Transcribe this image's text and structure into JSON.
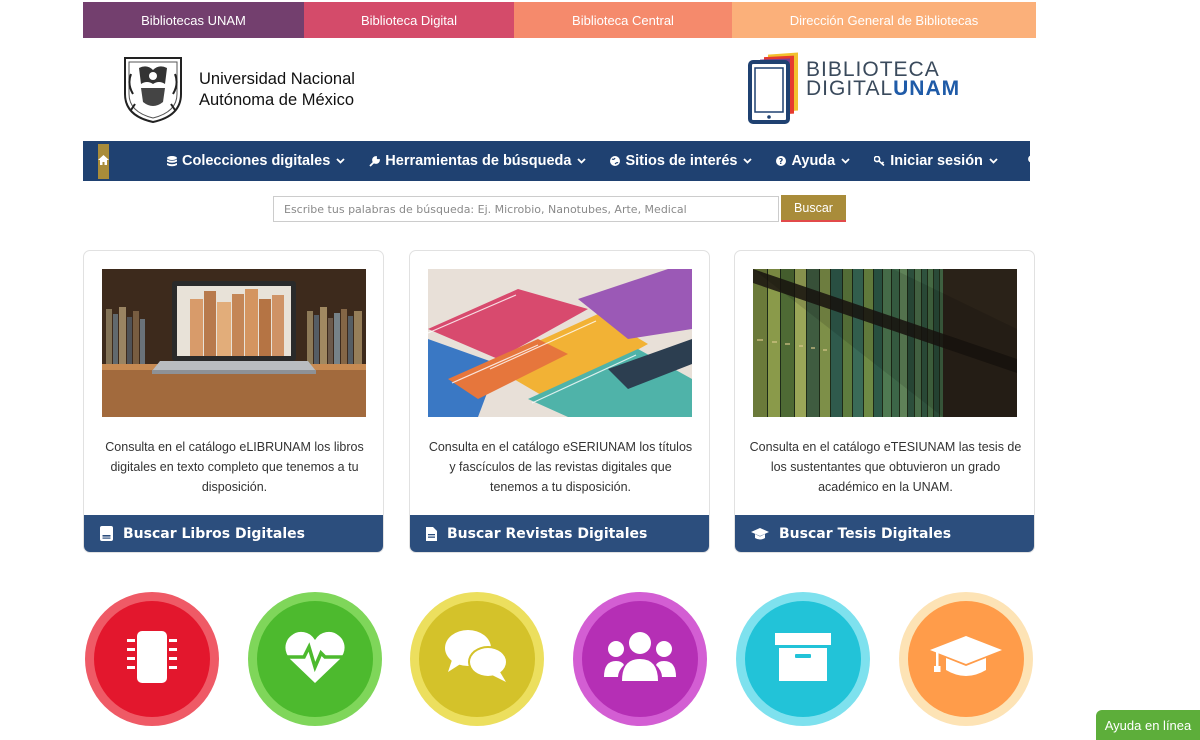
{
  "topbar": {
    "links": [
      "Bibliotecas UNAM",
      "Biblioteca Digital",
      "Biblioteca Central",
      "Dirección General de Bibliotecas"
    ],
    "colors": [
      "#733f6e",
      "#d44b6a",
      "#f58a6c",
      "#fbb07a"
    ]
  },
  "header": {
    "unam_line1": "Universidad Nacional",
    "unam_line2": "Autónoma de México",
    "logo_line1": "BIBLIOTECA",
    "logo_line2a": "DIGITAL",
    "logo_line2b": "UNAM"
  },
  "nav": {
    "home_icon": "home-icon",
    "items": [
      {
        "label": "Colecciones digitales",
        "icon": "database-icon"
      },
      {
        "label": "Herramientas de búsqueda",
        "icon": "wrench-icon"
      },
      {
        "label": "Sitios de interés",
        "icon": "globe-icon"
      },
      {
        "label": "Ayuda",
        "icon": "question-icon"
      },
      {
        "label": "Iniciar sesión",
        "icon": "key-icon"
      }
    ],
    "search_icon": "search-icon",
    "bg_color": "#1f4171",
    "accent_color": "#a98c3a"
  },
  "search": {
    "placeholder": "Escribe tus palabras de búsqueda: Ej. Microbio, Nanotubes, Arte, Medical",
    "button_label": "Buscar"
  },
  "cards": [
    {
      "desc": "Consulta en el catálogo eLIBRUNAM los libros digitales en texto completo que tenemos a tu disposición.",
      "cta": "Buscar Libros Digitales",
      "icon": "book-icon",
      "image": "laptop-books-photo"
    },
    {
      "desc": "Consulta en el catálogo eSERIUNAM los títulos y fascículos de las revistas digitales que tenemos a tu disposición.",
      "cta": "Buscar Revistas Digitales",
      "icon": "document-icon",
      "image": "magazines-photo"
    },
    {
      "desc": "Consulta en el catálogo eTESIUNAM las tesis de los sustentantes que obtuvieron un grado académico en la UNAM.",
      "cta": "Buscar Tesis Digitales",
      "icon": "graduation-cap-icon",
      "image": "bookshelf-photo"
    }
  ],
  "circles": [
    {
      "icon": "microchip-icon",
      "ring": "#ef5a66",
      "fill": "#e3172d"
    },
    {
      "icon": "heartbeat-icon",
      "ring": "#7fd65a",
      "fill": "#4dba2e"
    },
    {
      "icon": "comments-icon",
      "ring": "#ecdf5e",
      "fill": "#d4c22a"
    },
    {
      "icon": "users-icon",
      "ring": "#d35ed3",
      "fill": "#b52fb5"
    },
    {
      "icon": "archive-icon",
      "ring": "#7ee1ee",
      "fill": "#22c3d8"
    },
    {
      "icon": "graduation-cap-icon",
      "ring": "#fde3b5",
      "fill": "#ff9c4a"
    }
  ],
  "help_button": "Ayuda en línea"
}
